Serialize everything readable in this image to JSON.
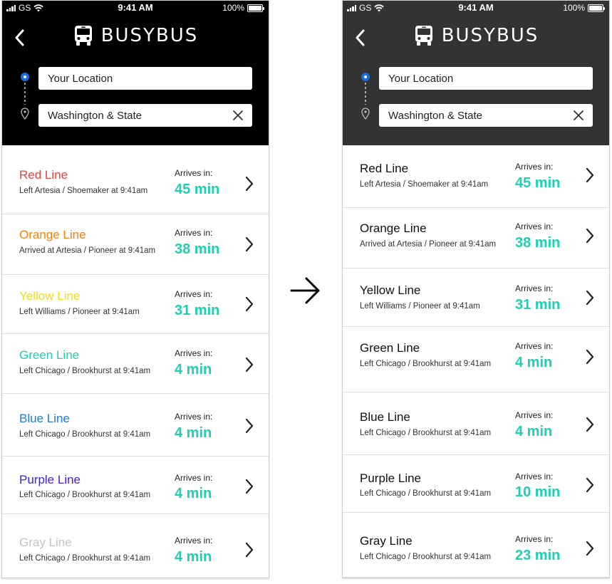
{
  "status": {
    "carrier": "GS",
    "time": "9:41 AM",
    "battery": "100%"
  },
  "brand": {
    "name": "BUSYBUS"
  },
  "search": {
    "from_value": "Your Location",
    "to_value": "Washington & State"
  },
  "arrives_label": "Arrives in:",
  "colors": {
    "accent_teal": "#1bd1b0",
    "header_dark": "#000000",
    "header_gray": "#333333",
    "location_blue": "#1a6fd8"
  },
  "left_screen": {
    "lines": [
      {
        "name": "Red Line",
        "color": "#e8423f",
        "sub": "Left Artesia / Shoemaker at 9:41am",
        "time": "45 min"
      },
      {
        "name": "Orange Line",
        "color": "#f5800f",
        "sub": "Arrived at Artesia / Pioneer at 9:41am",
        "time": "38 min"
      },
      {
        "name": "Yellow Line",
        "color": "#f2dc1a",
        "sub": "Left Williams / Pioneer at 9:41am",
        "time": "31 min"
      },
      {
        "name": "Green Line",
        "color": "#23cfae",
        "sub": "Left Chicago / Brookhurst at 9:41am",
        "time": "4 min"
      },
      {
        "name": "Blue Line",
        "color": "#1d7ed8",
        "sub": "Left Chicago / Brookhurst at 9:41am",
        "time": "4 min"
      },
      {
        "name": "Purple Line",
        "color": "#3f1ee0",
        "sub": "Left Chicago / Brookhurst at 9:41am",
        "time": "4 min"
      },
      {
        "name": "Gray Line",
        "color": "#c4c4c4",
        "sub": "Left Chicago / Brookhurst at 9:41am",
        "time": "4 min"
      }
    ]
  },
  "right_screen": {
    "lines": [
      {
        "name": "Red Line",
        "color": "#111111",
        "sub": "Left Artesia / Shoemaker at 9:41am",
        "time": "45 min"
      },
      {
        "name": "Orange Line",
        "color": "#111111",
        "sub": "Arrived at Artesia / Pioneer at 9:41am",
        "time": "38 min"
      },
      {
        "name": "Yellow Line",
        "color": "#111111",
        "sub": "Left Williams / Pioneer at 9:41am",
        "time": "31 min"
      },
      {
        "name": "Green Line",
        "color": "#111111",
        "sub": "Left Chicago / Brookhurst at 9:41am",
        "time": "4 min"
      },
      {
        "name": "Blue Line",
        "color": "#111111",
        "sub": "Left Chicago / Brookhurst at 9:41am",
        "time": "4 min"
      },
      {
        "name": "Purple Line",
        "color": "#111111",
        "sub": "Left Chicago / Brookhurst at 9:41am",
        "time": "10 min"
      },
      {
        "name": "Gray Line",
        "color": "#111111",
        "sub": "Left Chicago / Brookhurst at 9:41am",
        "time": "23 min"
      }
    ]
  }
}
